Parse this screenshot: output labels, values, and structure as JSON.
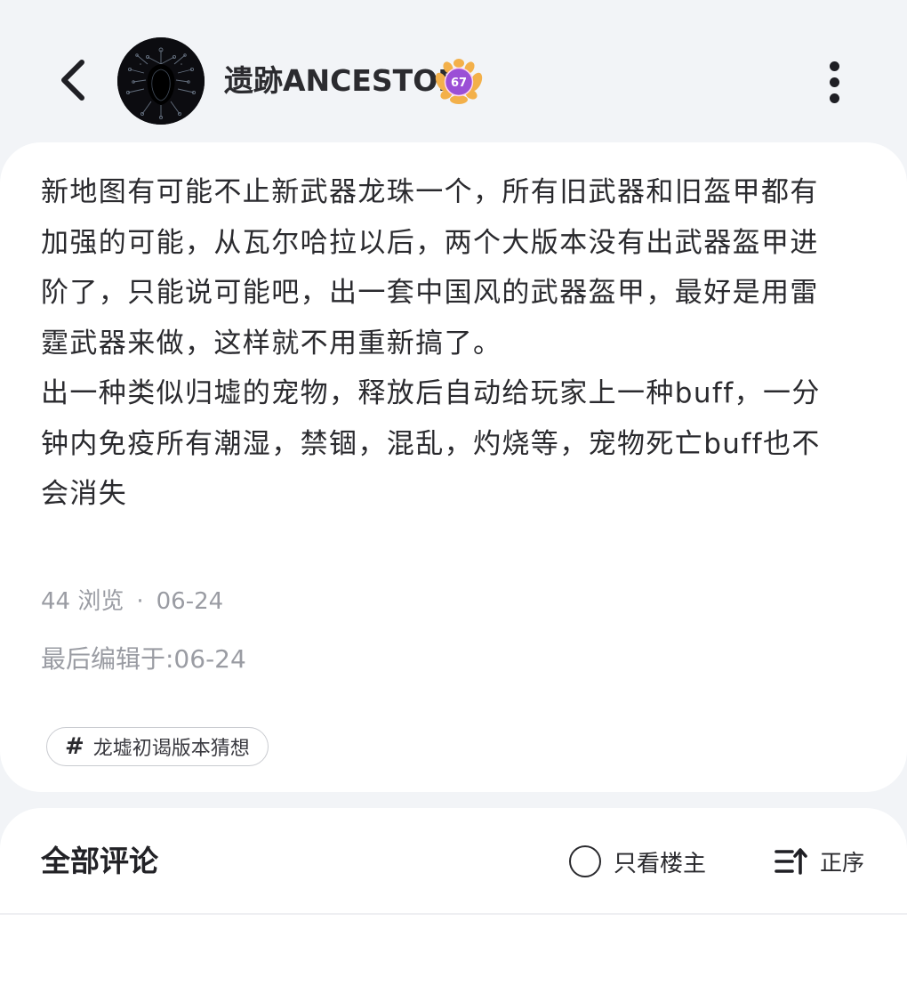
{
  "header": {
    "back_icon": "chevron-left-icon",
    "username": "遗跡ANCESTOR",
    "level": "67",
    "more_icon": "more-vertical-icon"
  },
  "post": {
    "paragraphs": [
      "新地图有可能不止新武器龙珠一个，所有旧武器和旧盔甲都有加强的可能，从瓦尔哈拉以后，两个大版本没有出武器盔甲进阶了，只能说可能吧，出一套中国风的武器盔甲，最好是用雷霆武器来做，这样就不用重新搞了。",
      "出一种类似归墟的宠物，释放后自动给玩家上一种buff，一分钟内免疫所有潮湿，禁锢，混乱，灼烧等，宠物死亡buff也不会消失"
    ],
    "views": "44 浏览",
    "separator": "·",
    "date": "06-24",
    "edited": "最后编辑于:06-24",
    "topic_hash": "#",
    "topic": "龙墟初谒版本猜想"
  },
  "comments": {
    "title": "全部评论",
    "op_only_label": "只看楼主",
    "sort_label": "正序",
    "sort_icon": "sort-ascending-icon"
  },
  "colors": {
    "background": "#f2f4f7",
    "card": "#ffffff",
    "muted_text": "#9a9ca3",
    "level_badge": "#9b4fd6",
    "level_badge_wreath": "#f3b04a"
  }
}
